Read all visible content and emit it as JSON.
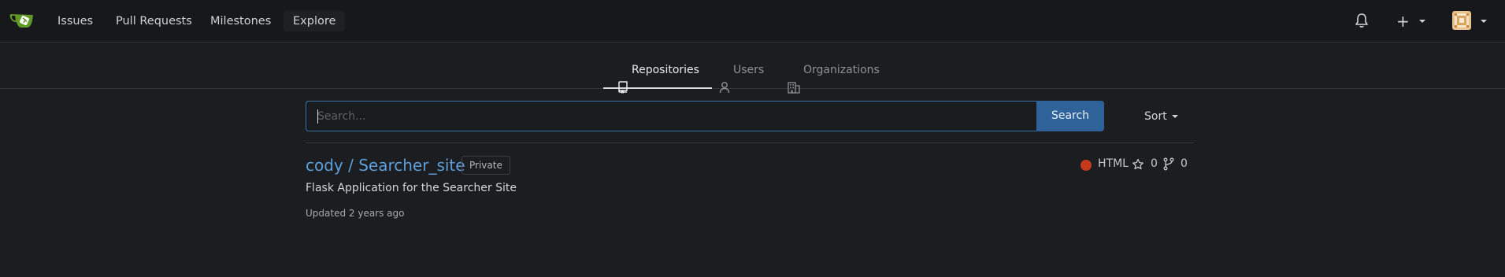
{
  "nav": {
    "items": [
      {
        "label": "Issues"
      },
      {
        "label": "Pull Requests"
      },
      {
        "label": "Milestones"
      },
      {
        "label": "Explore"
      }
    ],
    "plus_label": "+"
  },
  "tabs": [
    {
      "label": "Repositories",
      "active": true
    },
    {
      "label": "Users",
      "active": false
    },
    {
      "label": "Organizations",
      "active": false
    }
  ],
  "search": {
    "placeholder": "Search...",
    "value": "",
    "button_label": "Search",
    "sort_label": "Sort"
  },
  "repo": {
    "owner_repo": "cody / Searcher_site",
    "visibility": "Private",
    "description": "Flask Application for the Searcher Site",
    "updated": "Updated 2 years ago",
    "language": "HTML",
    "language_color": "#c7391b",
    "stars": "0",
    "forks": "0"
  },
  "colors": {
    "accent": "#30629a",
    "link": "#5c9fd9",
    "background": "#1c1d21",
    "logo_green": "#609926"
  }
}
